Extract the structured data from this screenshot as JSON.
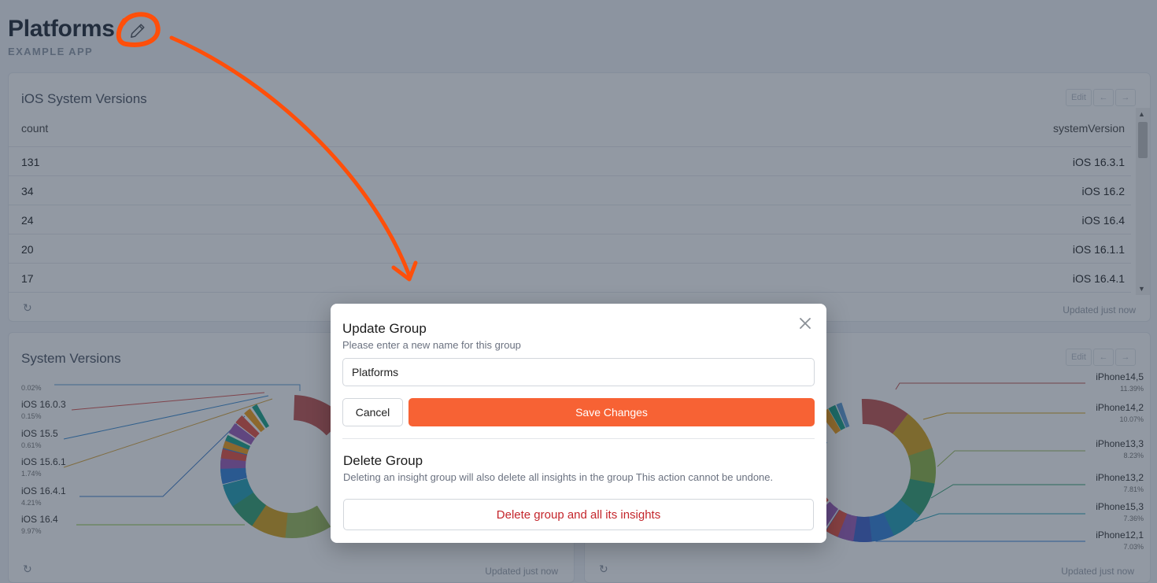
{
  "header": {
    "title": "Platforms",
    "subtitle": "EXAMPLE APP"
  },
  "table_card": {
    "title": "iOS System Versions",
    "edit_label": "Edit",
    "prev_label": "←",
    "next_label": "→",
    "columns": [
      "count",
      "systemVersion"
    ],
    "rows": [
      {
        "count": "131",
        "version": "iOS 16.3.1"
      },
      {
        "count": "34",
        "version": "iOS 16.2"
      },
      {
        "count": "24",
        "version": "iOS 16.4"
      },
      {
        "count": "20",
        "version": "iOS 16.1.1"
      },
      {
        "count": "17",
        "version": "iOS 16.4.1"
      }
    ],
    "updated": "Updated just now"
  },
  "left_chart_card": {
    "title": "System Versions",
    "updated": "Updated just now",
    "legend": [
      {
        "label": "",
        "pct": "0.02%"
      },
      {
        "label": "iOS  16.0.3",
        "pct": "0.15%"
      },
      {
        "label": "iOS  15.5",
        "pct": "0.61%"
      },
      {
        "label": "iOS  15.6.1",
        "pct": "1.74%"
      },
      {
        "label": "iOS  16.4.1",
        "pct": "4.21%"
      },
      {
        "label": "iOS  16.4",
        "pct": "9.97%"
      }
    ]
  },
  "right_chart_card": {
    "edit_label": "Edit",
    "prev_label": "←",
    "next_label": "→",
    "updated": "Updated just now",
    "legend": [
      {
        "label": "iPhone14,5",
        "pct": "11.39%"
      },
      {
        "label": "iPhone14,2",
        "pct": "10.07%"
      },
      {
        "label": "iPhone13,3",
        "pct": "8.23%"
      },
      {
        "label": "iPhone13,2",
        "pct": "7.81%"
      },
      {
        "label": "iPhone15,3",
        "pct": "7.36%"
      },
      {
        "label": "iPhone12,1",
        "pct": "7.03%"
      }
    ]
  },
  "modal": {
    "title": "Update Group",
    "subtitle": "Please enter a new name for this group",
    "name_value": "Platforms",
    "cancel_label": "Cancel",
    "save_label": "Save Changes",
    "delete_title": "Delete Group",
    "delete_warning": "Deleting an insight group will also delete all insights in the group This action cannot be undone.",
    "delete_label": "Delete group and all its insights"
  },
  "colors": {
    "accent": "#f76234",
    "danger": "#c4252b",
    "annotation": "#ff4f0a"
  }
}
